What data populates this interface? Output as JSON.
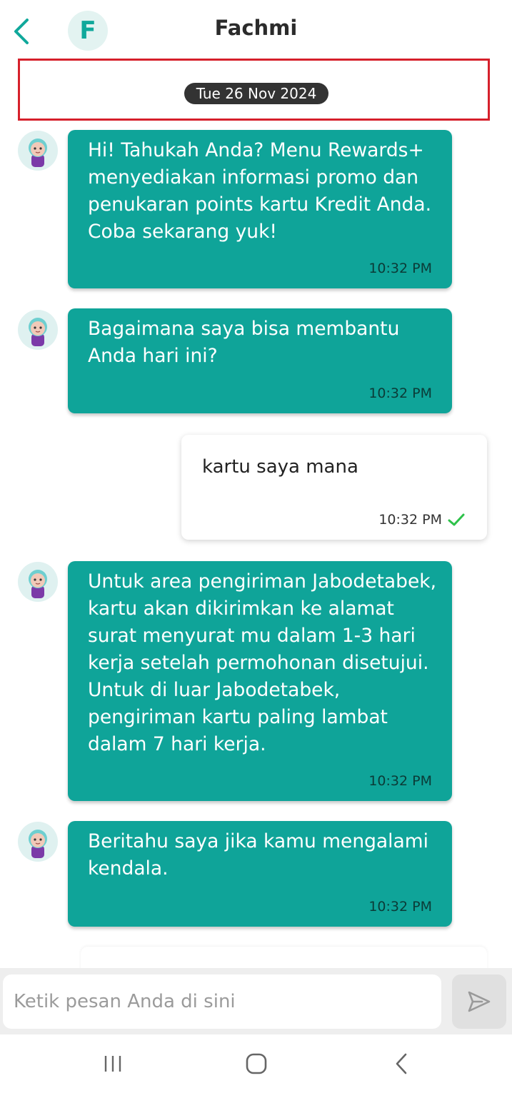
{
  "header": {
    "title": "Fachmi",
    "avatar_letter": "F",
    "back_icon": "chevron-left-icon"
  },
  "date_separator": "Tue 26 Nov 2024",
  "messages": [
    {
      "sender": "bot",
      "text": "Hi! Tahukah Anda? Menu Rewards+ menyediakan informasi promo dan penukaran points kartu Kredit Anda. Coba sekarang yuk!",
      "time": "10:32 PM"
    },
    {
      "sender": "bot",
      "text": "Bagaimana saya bisa membantu Anda hari ini?",
      "time": "10:32 PM"
    },
    {
      "sender": "user",
      "text": "kartu saya mana",
      "time": "10:32 PM",
      "status": "read-check-icon"
    },
    {
      "sender": "bot",
      "text": "Untuk area pengiriman Jabodetabek, kartu akan dikirimkan ke alamat surat menyurat mu dalam 1-3 hari kerja setelah permohonan disetujui. Untuk di luar Jabodetabek, pengiriman kartu paling lambat dalam 7 hari kerja.",
      "time": "10:32 PM"
    },
    {
      "sender": "bot",
      "text": "Beritahu saya jika kamu mengalami kendala.",
      "time": "10:32 PM"
    }
  ],
  "composer": {
    "placeholder": "Ketik pesan Anda di sini",
    "value": "",
    "send_icon": "send-icon"
  },
  "system_nav": [
    "recent-apps-icon",
    "home-icon",
    "back-icon"
  ],
  "colors": {
    "bot_bubble": "#0fa499",
    "accent": "#10a89b",
    "date_highlight": "#d6202b",
    "check": "#2ec24a"
  }
}
